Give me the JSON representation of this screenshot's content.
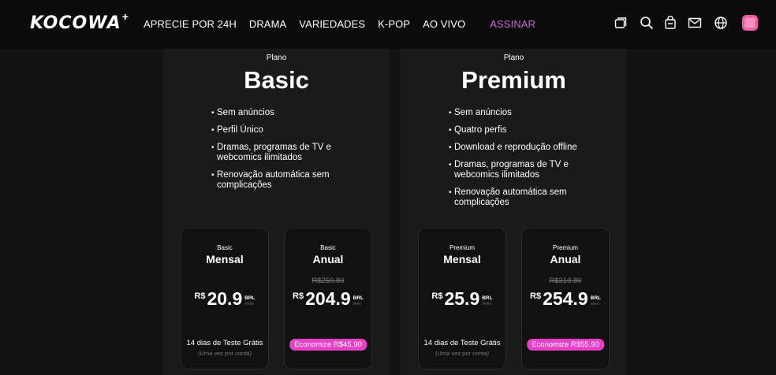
{
  "header": {
    "logo": "KOCOWA",
    "logo_plus": "+",
    "nav": [
      "APRECIE POR 24H",
      "DRAMA",
      "VARIEDADES",
      "K-POP",
      "AO VIVO"
    ],
    "subscribe": "ASSINAR",
    "icons": [
      "library-icon",
      "search-icon",
      "cart-icon",
      "mail-icon",
      "globe-icon",
      "profile-icon"
    ]
  },
  "plans": [
    {
      "label": "Plano",
      "name": "Basic",
      "features": [
        "Sem anúncios",
        "Perfil Único",
        "Dramas, programas de TV e webcomics ilimitados",
        "Renovação automática sem complicações"
      ],
      "cards": [
        {
          "tier": "Basic",
          "period": "Mensal",
          "old_price": "",
          "currency": "R$",
          "price": "20.9",
          "unit": "BRL",
          "per": "/mês",
          "trial": "14 dias de Teste Grátis",
          "trial_note": "(Uma vez por conta)",
          "save": ""
        },
        {
          "tier": "Basic",
          "period": "Anual",
          "old_price": "R$250.80",
          "currency": "R$",
          "price": "204.9",
          "unit": "BRL",
          "per": "/ano",
          "trial": "",
          "trial_note": "",
          "save": "Economize R$45.90"
        }
      ]
    },
    {
      "label": "Plano",
      "name": "Premium",
      "features": [
        "Sem anúncios",
        "Quatro perfis",
        "Download e reprodução offline",
        "Dramas, programas de TV e webcomics ilimitados",
        "Renovação automática sem complicações"
      ],
      "cards": [
        {
          "tier": "Premium",
          "period": "Mensal",
          "old_price": "",
          "currency": "R$",
          "price": "25.9",
          "unit": "BRL",
          "per": "/mês",
          "trial": "14 dias de Teste Grátis",
          "trial_note": "(Uma vez por conta)",
          "save": ""
        },
        {
          "tier": "Premium",
          "period": "Anual",
          "old_price": "R$310.80",
          "currency": "R$",
          "price": "254.9",
          "unit": "BRL",
          "per": "/ano",
          "trial": "",
          "trial_note": "",
          "save": "Economize R$55.90"
        }
      ]
    }
  ],
  "colors": {
    "accent": "#e83fc7",
    "subscribe": "#c46ad2",
    "background": "#121212",
    "panel": "#1a1a1a"
  }
}
